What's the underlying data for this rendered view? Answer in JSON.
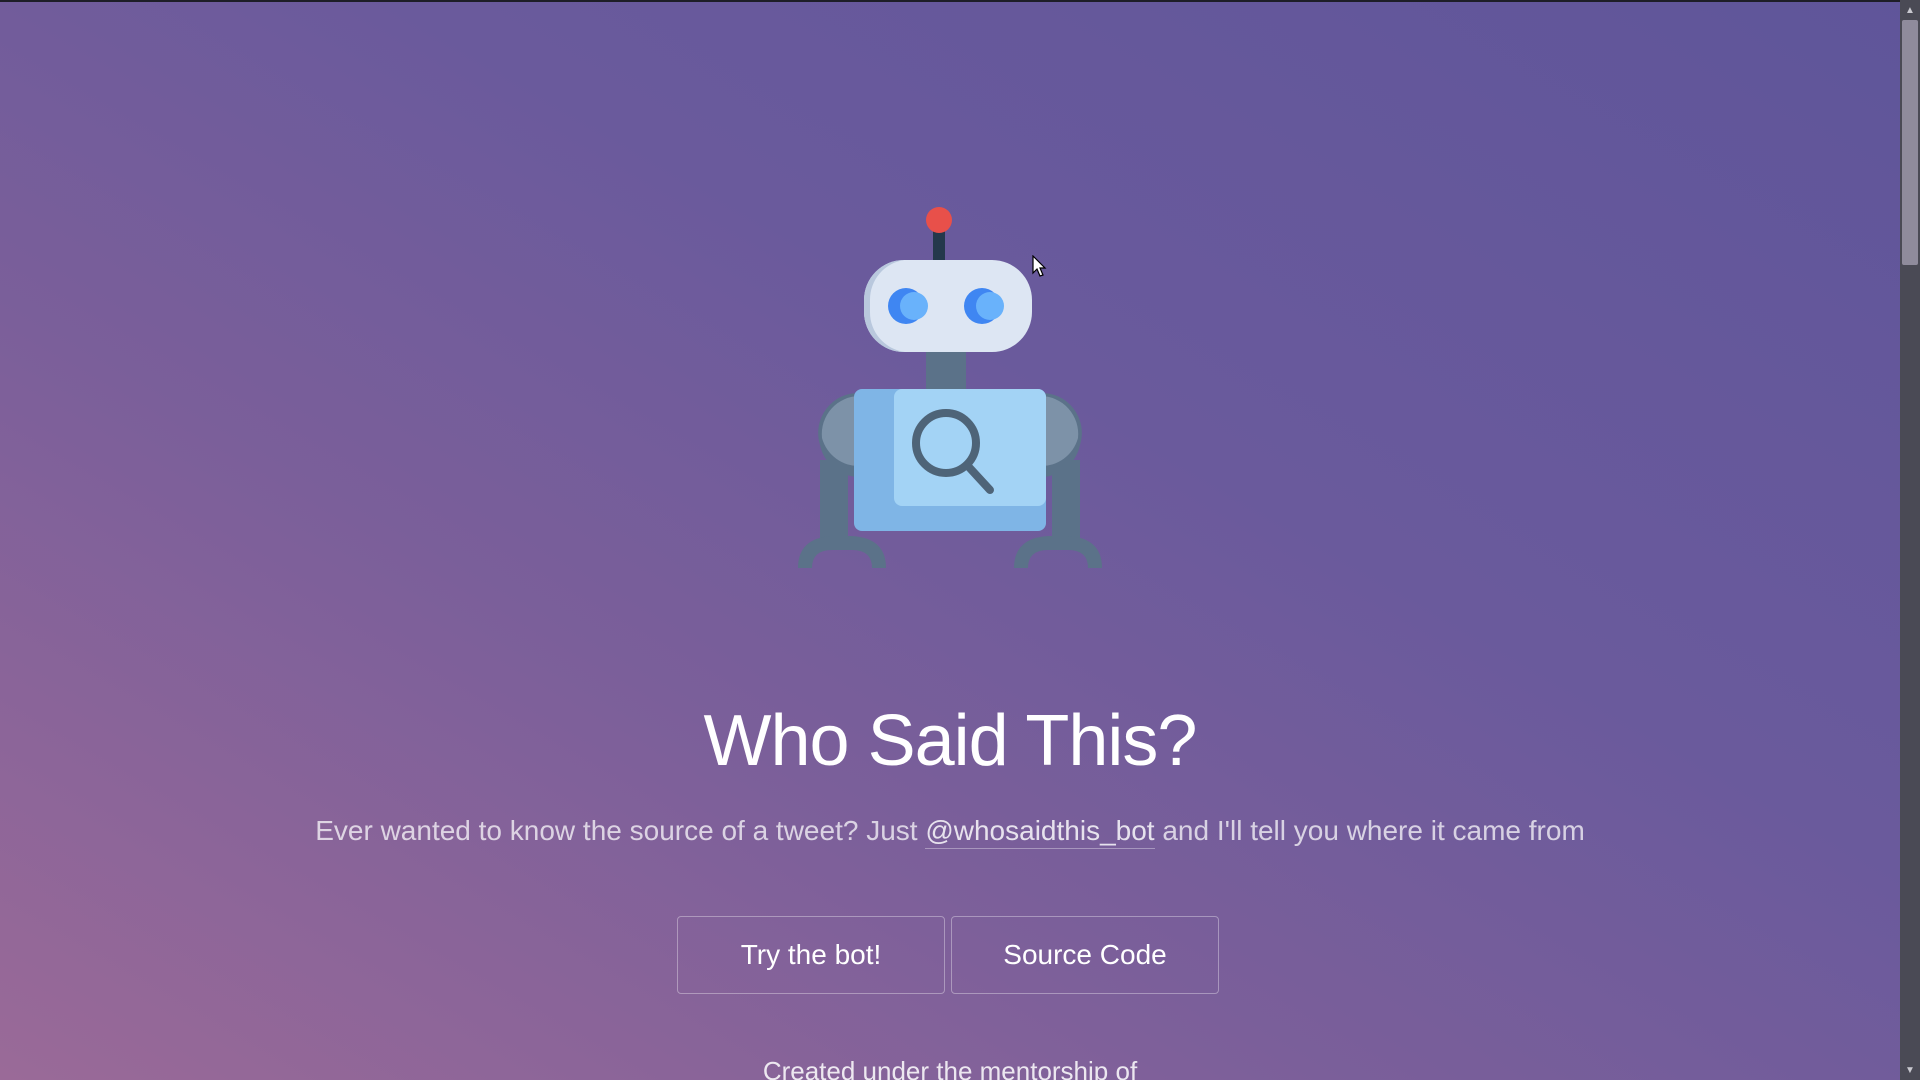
{
  "hero": {
    "title": "Who Said This?",
    "subtitle_before": "Ever wanted to know the source of a tweet? Just ",
    "handle": "@whosaidthis_bot",
    "subtitle_after": " and I'll tell you where it came from"
  },
  "buttons": {
    "try_label": "Try the bot!",
    "source_label": "Source Code"
  },
  "footer": {
    "text": "Created under the mentorship of"
  },
  "icons": {
    "robot": "robot-magnifier-illustration",
    "scroll_up": "scroll-up-arrow-icon",
    "scroll_down": "scroll-down-arrow-icon",
    "cursor": "mouse-pointer-icon"
  },
  "colors": {
    "background_start": "#9a6a98",
    "background_end": "#5f559a",
    "robot_antenna_ball": "#e8504a",
    "robot_eye": "#3f86f2",
    "robot_head": "#dde6f3",
    "robot_body": "#8ec6f0",
    "robot_limbs": "#5b7289"
  }
}
